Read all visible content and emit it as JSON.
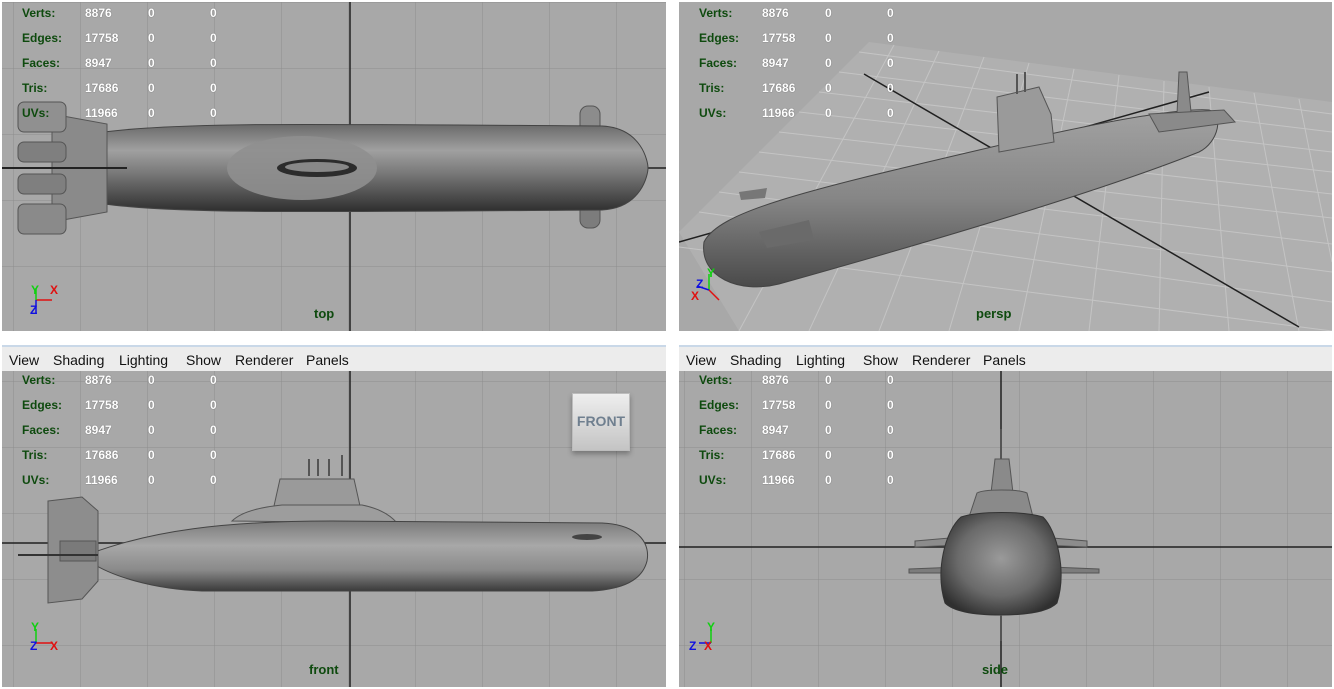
{
  "stats": {
    "rows": [
      {
        "label": "Verts:",
        "v1": "8876",
        "v2": "0",
        "v3": "0"
      },
      {
        "label": "Edges:",
        "v1": "17758",
        "v2": "0",
        "v3": "0"
      },
      {
        "label": "Faces:",
        "v1": "8947",
        "v2": "0",
        "v3": "0"
      },
      {
        "label": "Tris:",
        "v1": "17686",
        "v2": "0",
        "v3": "0"
      },
      {
        "label": "UVs:",
        "v1": "11966",
        "v2": "0",
        "v3": "0"
      }
    ]
  },
  "menu": [
    "View",
    "Shading",
    "Lighting",
    "Show",
    "Renderer",
    "Panels"
  ],
  "viewports": {
    "top": {
      "camera": "top"
    },
    "persp": {
      "camera": "persp"
    },
    "front": {
      "camera": "front",
      "view_cube": "FRONT"
    },
    "side": {
      "camera": "side"
    }
  },
  "axis_labels": {
    "x": "X",
    "y": "Y",
    "z": "Z"
  },
  "colors": {
    "viewport_bg": "#a8a8a8",
    "grid": "#8e8e8e",
    "hud_label": "#0e4a0e",
    "axis_x": "#e01010",
    "axis_y": "#10d010",
    "axis_z": "#1010e0"
  }
}
